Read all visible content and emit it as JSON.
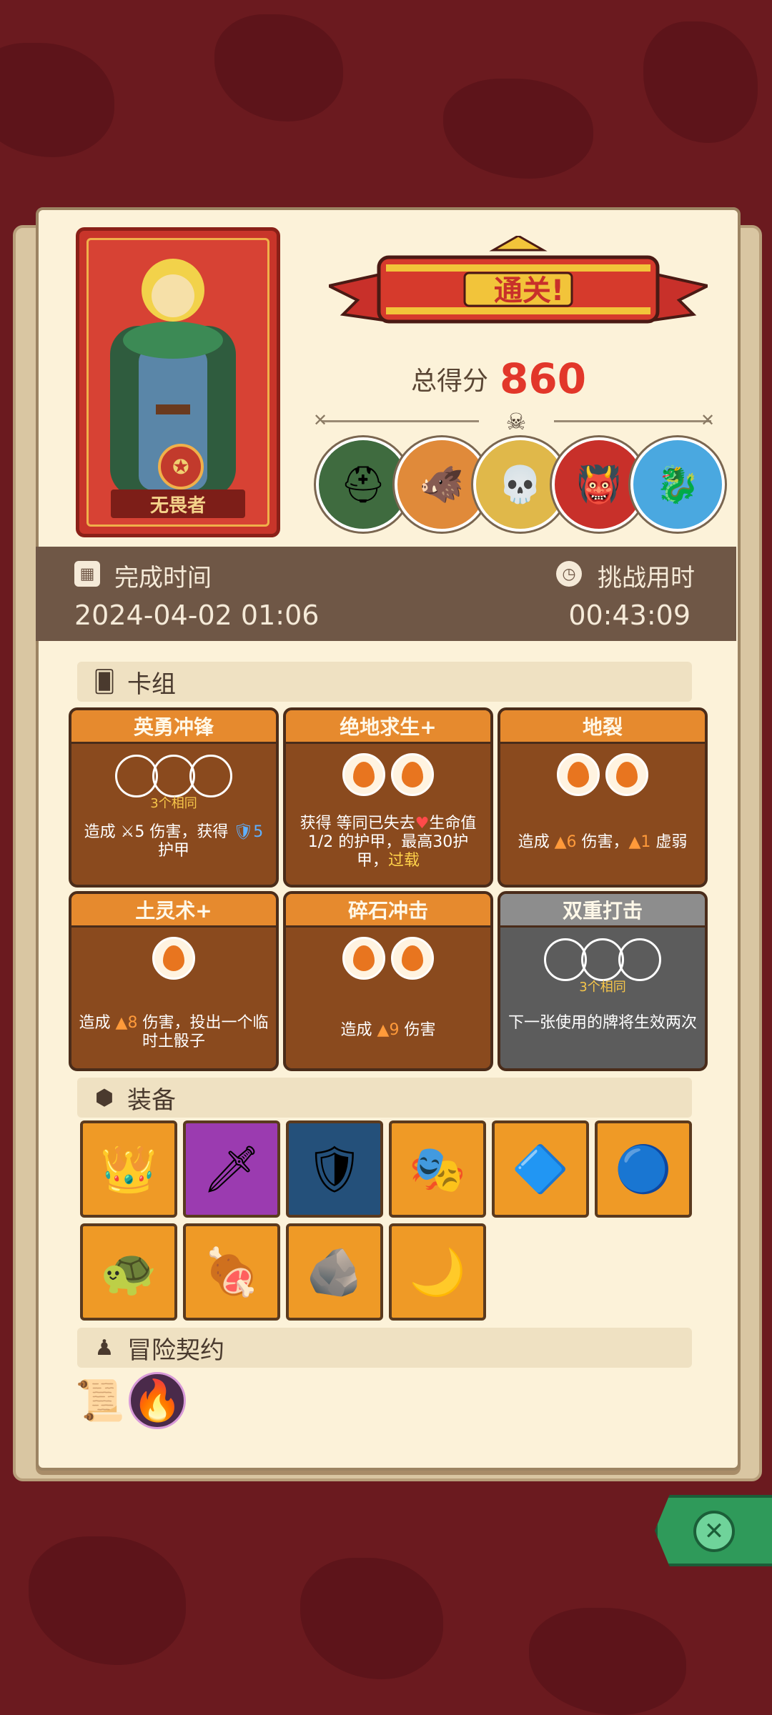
{
  "hero": {
    "name": "无畏者"
  },
  "result": {
    "banner": "通关!",
    "score_label": "总得分",
    "score_value": "860"
  },
  "bosses": [
    {
      "name": "armor-knight-boss",
      "color": "#3f6b3f",
      "glyph": "⛑"
    },
    {
      "name": "boar-boss",
      "color": "#e08a3a",
      "glyph": "🐗"
    },
    {
      "name": "skull-boss",
      "color": "#e0b84a",
      "glyph": "💀"
    },
    {
      "name": "demon-boss",
      "color": "#c8302a",
      "glyph": "👹"
    },
    {
      "name": "dragon-boss",
      "color": "#4aa8e0",
      "glyph": "🐉"
    }
  ],
  "times": {
    "finish_label": "完成时间",
    "finish_value": "2024-04-02 01:06",
    "duration_label": "挑战用时",
    "duration_value": "00:43:09"
  },
  "deck": {
    "title": "卡组",
    "cards": [
      {
        "title": "英勇冲锋",
        "same": "3个相同",
        "desc_html": "造成 ⚔5 伤害，获得 <span class='hl-blue'>🛡5</span> 护甲"
      },
      {
        "title": "绝地求生+",
        "desc_html": "获得 等同已失去<span class='hl-red'>♥</span>生命值1/2 的护甲，最高30护甲，<span class='hl-yellow'>过载</span>"
      },
      {
        "title": "地裂",
        "desc_html": "造成 <span class='hl-orange'>▲6</span> 伤害，<span class='hl-orange'>▲1</span> 虚弱"
      },
      {
        "title": "土灵术+",
        "desc_html": "造成 <span class='hl-orange'>▲8</span> 伤害，投出一个临时土骰子"
      },
      {
        "title": "碎石冲击",
        "desc_html": "造成 <span class='hl-orange'>▲9</span> 伤害"
      },
      {
        "title": "双重打击",
        "same": "3个相同",
        "desc_html": "下一张使用的牌将生效两次"
      }
    ]
  },
  "equipment": {
    "title": "装备",
    "items": [
      {
        "name": "crown",
        "bg": "#ef9a26",
        "glyph": "👑"
      },
      {
        "name": "red-dragon-dagger",
        "bg": "#9b3bb0",
        "glyph": "🗡"
      },
      {
        "name": "chest-armor-compass",
        "bg": "#24507a",
        "glyph": "🛡"
      },
      {
        "name": "spiked-mask",
        "bg": "#ef9a26",
        "glyph": "🎭"
      },
      {
        "name": "blue-shield",
        "bg": "#ef9a26",
        "glyph": "🔷"
      },
      {
        "name": "blue-orb",
        "bg": "#ef9a26",
        "glyph": "🔵"
      },
      {
        "name": "turtle-shell",
        "bg": "#ef9a26",
        "glyph": "🐢"
      },
      {
        "name": "meat-leg",
        "bg": "#ef9a26",
        "glyph": "🍖"
      },
      {
        "name": "moss-stone",
        "bg": "#ef9a26",
        "glyph": "🪨"
      },
      {
        "name": "pink-moon-orb",
        "bg": "#ef9a26",
        "glyph": "🌙"
      }
    ]
  },
  "contract": {
    "title": "冒险契约"
  },
  "colors": {
    "background": "#6b1a1f",
    "paper": "#fcf2d9",
    "band": "#6f5746",
    "accent": "#e2372a"
  }
}
